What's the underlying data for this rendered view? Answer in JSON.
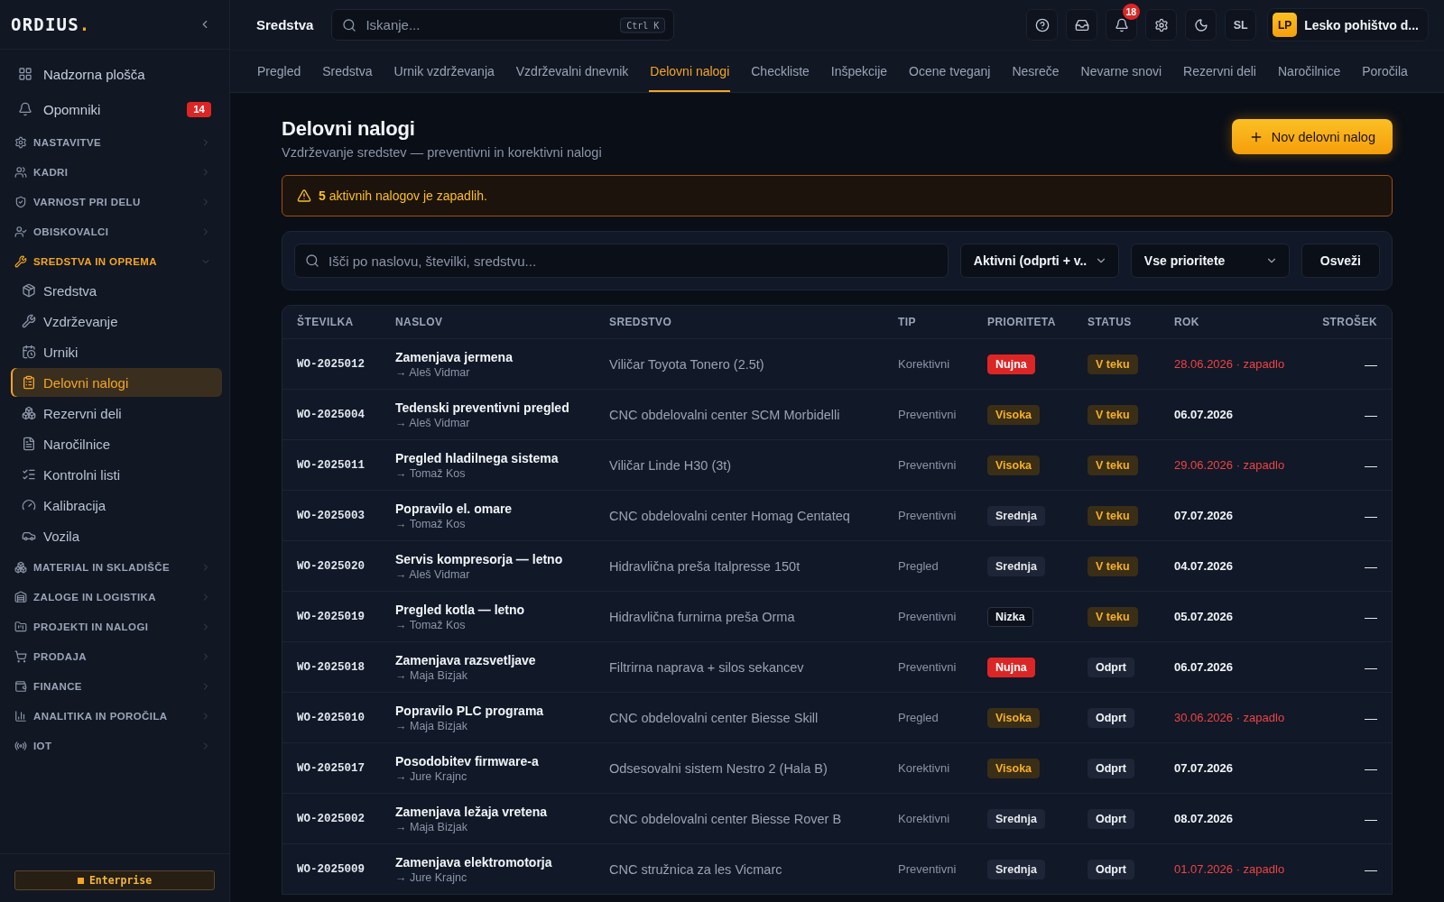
{
  "sidebar": {
    "logo": {
      "name": "ORDIUS",
      "mark": "."
    },
    "pinned": [
      {
        "label": "Nadzorna plošča",
        "selected": false
      },
      {
        "label": "Opomniki",
        "badge": "14",
        "selected": false
      }
    ],
    "groups": [
      {
        "label": "NASTAVITVE",
        "expanded": false
      },
      {
        "label": "KADRI",
        "expanded": false
      },
      {
        "label": "VARNOST PRI DELU",
        "expanded": false
      },
      {
        "label": "OBISKOVALCI",
        "expanded": false
      },
      {
        "label": "SREDSTVA IN OPREMA",
        "expanded": true,
        "children": [
          {
            "label": "Sredstva",
            "selected": false
          },
          {
            "label": "Vzdrževanje",
            "selected": false
          },
          {
            "label": "Urniki",
            "selected": false
          },
          {
            "label": "Delovni nalogi",
            "selected": true
          },
          {
            "label": "Rezervni deli",
            "selected": false
          },
          {
            "label": "Naročilnice",
            "selected": false
          },
          {
            "label": "Kontrolni listi",
            "selected": false
          },
          {
            "label": "Kalibracija",
            "selected": false
          },
          {
            "label": "Vozila",
            "selected": false
          }
        ]
      },
      {
        "label": "MATERIAL IN SKLADIŠČE",
        "expanded": false
      },
      {
        "label": "ZALOGE IN LOGISTIKA",
        "expanded": false
      },
      {
        "label": "PROJEKTI IN NALOGI",
        "expanded": false
      },
      {
        "label": "PRODAJA",
        "expanded": false
      },
      {
        "label": "FINANCE",
        "expanded": false
      },
      {
        "label": "ANALITIKA IN POROČILA",
        "expanded": false
      },
      {
        "label": "IOT",
        "expanded": false
      }
    ],
    "plan": "Enterprise"
  },
  "topbar": {
    "title": "Sredstva",
    "search": {
      "placeholder": "Iskanje...",
      "shortcut": "Ctrl K"
    },
    "notifications": "18",
    "user_initials": "SL",
    "organization": {
      "initials": "LP",
      "name": "Lesko pohištvo d..."
    }
  },
  "tabs": [
    {
      "label": "Pregled",
      "selected": false
    },
    {
      "label": "Sredstva",
      "selected": false
    },
    {
      "label": "Urnik vzdrževanja",
      "selected": false
    },
    {
      "label": "Vzdrževalni dnevnik",
      "selected": false
    },
    {
      "label": "Delovni nalogi",
      "selected": true
    },
    {
      "label": "Checkliste",
      "selected": false
    },
    {
      "label": "Inšpekcije",
      "selected": false
    },
    {
      "label": "Ocene tveganj",
      "selected": false
    },
    {
      "label": "Nesreče",
      "selected": false
    },
    {
      "label": "Nevarne snovi",
      "selected": false
    },
    {
      "label": "Rezervni deli",
      "selected": false
    },
    {
      "label": "Naročilnice",
      "selected": false
    },
    {
      "label": "Poročila",
      "selected": false
    }
  ],
  "page": {
    "title": "Delovni nalogi",
    "subtitle": "Vzdrževanje sredstev — preventivni in korektivni nalogi",
    "new_button": "Nov delovni nalog"
  },
  "alert": {
    "text": "**5** aktivnih nalogov je zapadlih."
  },
  "filters": {
    "search": {
      "placeholder": "Išči po naslovu, številki, sredstvu..."
    },
    "status": "Aktivni (odprti + v..",
    "priority": "Vse prioritete",
    "refresh": "Osveži"
  },
  "table": {
    "columns": [
      "ŠTEVILKA",
      "NASLOV",
      "SREDSTVO",
      "TIP",
      "PRIORITETA",
      "STATUS",
      "ROK",
      "STROŠEK"
    ],
    "rows": [
      {
        "number": "WO-2025012",
        "title": "Zamenjava jermena",
        "assignee": "→ Aleš Vidmar",
        "asset": "Viličar Toyota Tonero (2.5t)",
        "type": "Korektivni",
        "priority": {
          "text": "Nujna",
          "kind": "urgent"
        },
        "status": {
          "text": "V teku",
          "kind": "in_progress"
        },
        "due": "28.06.2026 · zapadlo",
        "overdue": true,
        "cost": "—"
      },
      {
        "number": "WO-2025004",
        "title": "Tedenski preventivni pregled",
        "assignee": "→ Aleš Vidmar",
        "asset": "CNC obdelovalni center SCM Morbidelli",
        "type": "Preventivni",
        "priority": {
          "text": "Visoka",
          "kind": "high"
        },
        "status": {
          "text": "V teku",
          "kind": "in_progress"
        },
        "due": "06.07.2026",
        "overdue": false,
        "cost": "—"
      },
      {
        "number": "WO-2025011",
        "title": "Pregled hladilnega sistema",
        "assignee": "→ Tomaž Kos",
        "asset": "Viličar Linde H30 (3t)",
        "type": "Preventivni",
        "priority": {
          "text": "Visoka",
          "kind": "high"
        },
        "status": {
          "text": "V teku",
          "kind": "in_progress"
        },
        "due": "29.06.2026 · zapadlo",
        "overdue": true,
        "cost": "—"
      },
      {
        "number": "WO-2025003",
        "title": "Popravilo el. omare",
        "assignee": "→ Tomaž Kos",
        "asset": "CNC obdelovalni center Homag Centateq",
        "type": "Preventivni",
        "priority": {
          "text": "Srednja",
          "kind": "medium"
        },
        "status": {
          "text": "V teku",
          "kind": "in_progress"
        },
        "due": "07.07.2026",
        "overdue": false,
        "cost": "—"
      },
      {
        "number": "WO-2025020",
        "title": "Servis kompresorja — letno",
        "assignee": "→ Aleš Vidmar",
        "asset": "Hidravlična preša Italpresse 150t",
        "type": "Pregled",
        "priority": {
          "text": "Srednja",
          "kind": "medium"
        },
        "status": {
          "text": "V teku",
          "kind": "in_progress"
        },
        "due": "04.07.2026",
        "overdue": false,
        "cost": "—"
      },
      {
        "number": "WO-2025019",
        "title": "Pregled kotla — letno",
        "assignee": "→ Tomaž Kos",
        "asset": "Hidravlična furnirna preša Orma",
        "type": "Preventivni",
        "priority": {
          "text": "Nizka",
          "kind": "low"
        },
        "status": {
          "text": "V teku",
          "kind": "in_progress"
        },
        "due": "05.07.2026",
        "overdue": false,
        "cost": "—"
      },
      {
        "number": "WO-2025018",
        "title": "Zamenjava razsvetljave",
        "assignee": "→ Maja Bizjak",
        "asset": "Filtrirna naprava + silos sekancev",
        "type": "Preventivni",
        "priority": {
          "text": "Nujna",
          "kind": "urgent"
        },
        "status": {
          "text": "Odprt",
          "kind": "open"
        },
        "due": "06.07.2026",
        "overdue": false,
        "cost": "—"
      },
      {
        "number": "WO-2025010",
        "title": "Popravilo PLC programa",
        "assignee": "→ Maja Bizjak",
        "asset": "CNC obdelovalni center Biesse Skill",
        "type": "Pregled",
        "priority": {
          "text": "Visoka",
          "kind": "high"
        },
        "status": {
          "text": "Odprt",
          "kind": "open"
        },
        "due": "30.06.2026 · zapadlo",
        "overdue": true,
        "cost": "—"
      },
      {
        "number": "WO-2025017",
        "title": "Posodobitev firmware-a",
        "assignee": "→ Jure Krajnc",
        "asset": "Odsesovalni sistem Nestro 2 (Hala B)",
        "type": "Korektivni",
        "priority": {
          "text": "Visoka",
          "kind": "high"
        },
        "status": {
          "text": "Odprt",
          "kind": "open"
        },
        "due": "07.07.2026",
        "overdue": false,
        "cost": "—"
      },
      {
        "number": "WO-2025002",
        "title": "Zamenjava ležaja vretena",
        "assignee": "→ Maja Bizjak",
        "asset": "CNC obdelovalni center Biesse Rover B",
        "type": "Korektivni",
        "priority": {
          "text": "Srednja",
          "kind": "medium"
        },
        "status": {
          "text": "Odprt",
          "kind": "open"
        },
        "due": "08.07.2026",
        "overdue": false,
        "cost": "—"
      },
      {
        "number": "WO-2025009",
        "title": "Zamenjava elektromotorja",
        "assignee": "→ Jure Krajnc",
        "asset": "CNC stružnica za les Vicmarc",
        "type": "Preventivni",
        "priority": {
          "text": "Srednja",
          "kind": "medium"
        },
        "status": {
          "text": "Odprt",
          "kind": "open"
        },
        "due": "01.07.2026 · zapadlo",
        "overdue": true,
        "cost": "—"
      }
    ]
  }
}
